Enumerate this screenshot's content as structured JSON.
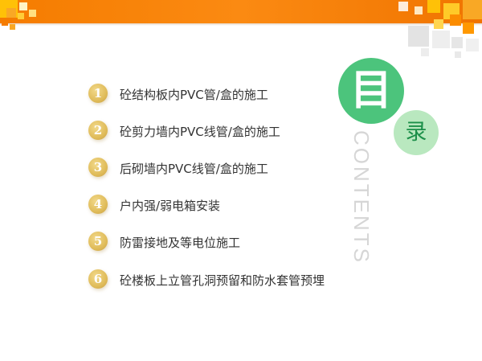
{
  "header": {
    "bar_color": "#f57c00"
  },
  "title": {
    "main": "目",
    "secondary": "录",
    "english": "CONTENTS",
    "main_color": "#4cc47c",
    "secondary_color": "#b9e8bf"
  },
  "toc": {
    "items": [
      {
        "num": "1",
        "label": "砼结构板内PVC管/盒的施工"
      },
      {
        "num": "2",
        "label": "砼剪力墙内PVC线管/盒的施工"
      },
      {
        "num": "3",
        "label": "后砌墙内PVC线管/盒的施工"
      },
      {
        "num": "4",
        "label": "户内强/弱电箱安装"
      },
      {
        "num": "5",
        "label": "防雷接地及等电位施工"
      },
      {
        "num": "6",
        "label": "砼楼板上立管孔洞预留和防水套管预埋"
      }
    ]
  }
}
